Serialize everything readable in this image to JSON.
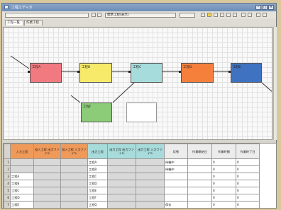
{
  "window": {
    "title": "工程エディタ"
  },
  "toolbar": {
    "combo_left": "",
    "combo_mid": "標準工程(表示)",
    "combo_right": ""
  },
  "tabs": [
    {
      "label": "工程一覧"
    },
    {
      "label": "作業工程"
    }
  ],
  "diagram": {
    "nodes": [
      {
        "label": "工程A",
        "color": "#f07a80"
      },
      {
        "label": "工程B",
        "color": "#f7ea6a"
      },
      {
        "label": "工程C",
        "color": "#a6dcdc"
      },
      {
        "label": "工程D",
        "color": "#f4803c"
      },
      {
        "label": "工程E",
        "color": "#3f72c0"
      },
      {
        "label": "工程F",
        "color": "#8ccc78"
      },
      {
        "label": "",
        "color": "#ffffff"
      }
    ]
  },
  "grid": {
    "headers": [
      "入力工程",
      "投入工程 出力ファイル",
      "投入工程 入力ファイル",
      "出力工程",
      "出力工程 出力ファイル",
      "出力工程 入力ファイル",
      "状態",
      "作業開始日",
      "作業時間",
      "作業終了日"
    ],
    "rows": [
      {
        "num": "1",
        "cells": [
          "",
          "",
          "",
          "工程A",
          "",
          "",
          "待機中",
          "",
          "0",
          "0"
        ]
      },
      {
        "num": "2",
        "cells": [
          "",
          "",
          "",
          "工程B",
          "",
          "",
          "待機中",
          "",
          "0",
          "0"
        ]
      },
      {
        "num": "3",
        "cells": [
          "工程A",
          "",
          "",
          "工程C",
          "",
          "",
          "",
          "",
          "0",
          "0"
        ]
      },
      {
        "num": "4",
        "cells": [
          "工程B",
          "",
          "",
          "工程D",
          "",
          "",
          "",
          "",
          "0",
          "0"
        ]
      },
      {
        "num": "5",
        "cells": [
          "工程C",
          "",
          "",
          "工程E",
          "",
          "",
          "",
          "",
          "0",
          "0"
        ]
      },
      {
        "num": "6",
        "cells": [
          "工程D",
          "",
          "",
          "工程F",
          "",
          "",
          "",
          "",
          "0",
          "0"
        ]
      },
      {
        "num": "7",
        "cells": [
          "工程E",
          "",
          "",
          "工程G",
          "",
          "",
          "保存",
          "",
          "0",
          "0"
        ]
      }
    ]
  }
}
